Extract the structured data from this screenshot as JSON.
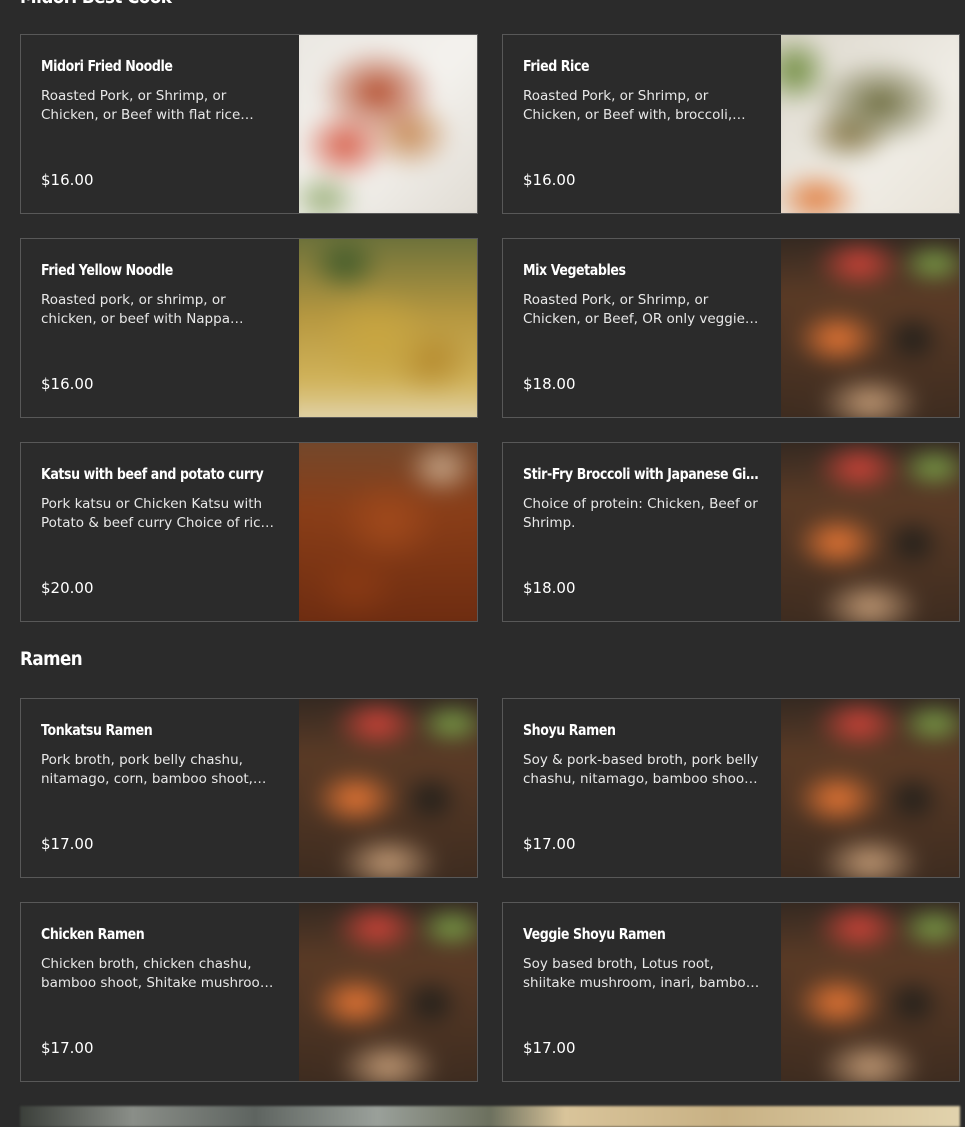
{
  "sections": [
    {
      "title": "Midori Best Cook"
    },
    {
      "title": "Ramen"
    }
  ],
  "items": [
    {
      "name": "Midori Fried Noodle",
      "description": "Roasted Pork, or Shrimp, or Chicken, or Beef with flat rice noodles",
      "price": "$16.00",
      "photo": "fried-noodle"
    },
    {
      "name": "Fried Rice",
      "description": "Roasted Pork, or Shrimp, or Chicken, or Beef with, broccoli, carrots and egg",
      "price": "$16.00",
      "photo": "fried-rice"
    },
    {
      "name": "Fried Yellow Noodle",
      "description": "Roasted pork, or shrimp, or chicken, or beef with Nappa cabbage",
      "price": "$16.00",
      "photo": "yellow-noodle"
    },
    {
      "name": "Mix Vegetables",
      "description": "Roasted Pork, or Shrimp, or Chicken, or Beef, OR only veggies available",
      "price": "$18.00",
      "photo": "sushi-platter"
    },
    {
      "name": "Katsu with beef and potato curry",
      "description": "Pork katsu or Chicken Katsu with Potato & beef curry Choice of rice or noodles",
      "price": "$20.00",
      "photo": "katsu-curry"
    },
    {
      "name": "Stir-Fry Broccoli with Japanese Ginger Sauce",
      "description": "Choice of protein: Chicken, Beef or Shrimp.",
      "price": "$18.00",
      "photo": "sushi-platter"
    },
    {
      "name": "Tonkatsu Ramen",
      "description": "Pork broth, pork belly chashu, nitamago, corn, bamboo shoot, scallion",
      "price": "$17.00",
      "photo": "sushi-platter"
    },
    {
      "name": "Shoyu Ramen",
      "description": "Soy & pork-based broth, pork belly chashu, nitamago, bamboo shoot, scallion",
      "price": "$17.00",
      "photo": "sushi-platter"
    },
    {
      "name": "Chicken Ramen",
      "description": "Chicken broth, chicken chashu, bamboo shoot, Shitake mushroom, scallion",
      "price": "$17.00",
      "photo": "sushi-platter"
    },
    {
      "name": "Veggie Shoyu Ramen",
      "description": "Soy based broth, Lotus root, shiitake mushroom, inari, bamboo shoot",
      "price": "$17.00",
      "photo": "sushi-platter"
    }
  ]
}
